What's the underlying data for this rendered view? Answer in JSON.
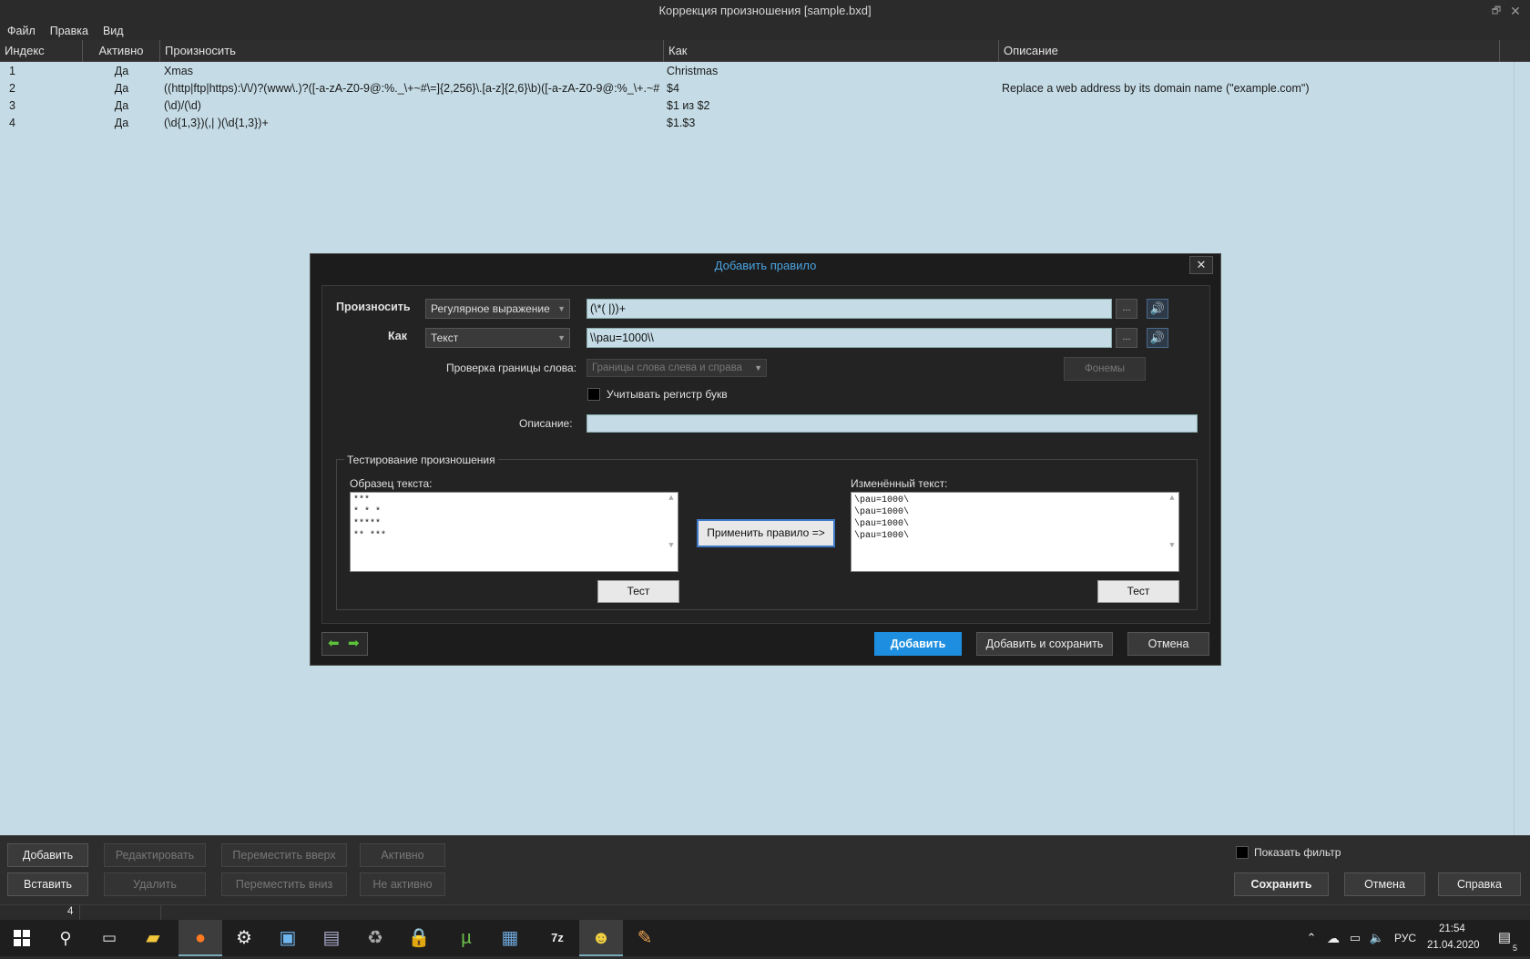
{
  "window": {
    "title": "Коррекция произношения [sample.bxd]"
  },
  "menu": {
    "file": "Файл",
    "edit": "Правка",
    "view": "Вид"
  },
  "table": {
    "headers": {
      "index": "Индекс",
      "active": "Активно",
      "pronounce": "Произносить",
      "as": "Как",
      "description": "Описание"
    },
    "rows": [
      {
        "index": "1",
        "active": "Да",
        "pronounce": "Xmas",
        "as": "Christmas",
        "description": ""
      },
      {
        "index": "2",
        "active": "Да",
        "pronounce": "((http|ftp|https):\\/\\/)?(www\\.)?([-a-zA-Z0-9@:%._\\+~#\\=]{2,256}\\.[a-z]{2,6}\\b)([-a-zA-Z0-9@:%_\\+.~#?&//\\...",
        "as": "$4",
        "description": "Replace a web address by its domain name (\"example.com\")"
      },
      {
        "index": "3",
        "active": "Да",
        "pronounce": "(\\d)/(\\d)",
        "as": "$1 из $2",
        "description": ""
      },
      {
        "index": "4",
        "active": "Да",
        "pronounce": "(\\d{1,3})(,| )(\\d{1,3})+",
        "as": "$1.$3",
        "description": ""
      }
    ]
  },
  "dialog": {
    "title": "Добавить правило",
    "pronounce_label": "Произносить",
    "pronounce_type": "Регулярное выражение",
    "pronounce_value": "(\\*( |))+",
    "as_label": "Как",
    "as_type": "Текст",
    "as_value": "\\\\pau=1000\\\\",
    "browse": "...",
    "boundary_label": "Проверка границы слова:",
    "boundary_value": "Границы слова слева и справа",
    "phonemes_btn": "Фонемы",
    "case_label": "Учитывать регистр букв",
    "description_label": "Описание:",
    "description_value": "",
    "test_group": "Тестирование произношения",
    "sample_label": "Образец текста:",
    "sample_text": "***\n* * *\n*****\n** ***",
    "apply_btn": "Применить правило =>",
    "changed_label": "Изменённый текст:",
    "changed_text": "\\pau=1000\\\n\\pau=1000\\\n\\pau=1000\\\n\\pau=1000\\",
    "test_btn": "Тест",
    "add_btn": "Добавить",
    "add_save_btn": "Добавить и сохранить",
    "cancel_btn": "Отмена"
  },
  "bottom": {
    "add": "Добавить",
    "edit": "Редактировать",
    "move_up": "Переместить вверх",
    "active": "Активно",
    "insert": "Вставить",
    "delete": "Удалить",
    "move_down": "Переместить вниз",
    "inactive": "Не активно",
    "show_filter": "Показать фильтр",
    "save": "Сохранить",
    "cancel": "Отмена",
    "help": "Справка"
  },
  "status": {
    "count": "4"
  },
  "taskbar": {
    "lang": "РУС",
    "time": "21:54",
    "date": "21.04.2020",
    "notifications": "5"
  },
  "colors": {
    "accent": "#1e8fe0",
    "table_bg": "#c5dce6",
    "title_blue": "#4aa3e0"
  }
}
